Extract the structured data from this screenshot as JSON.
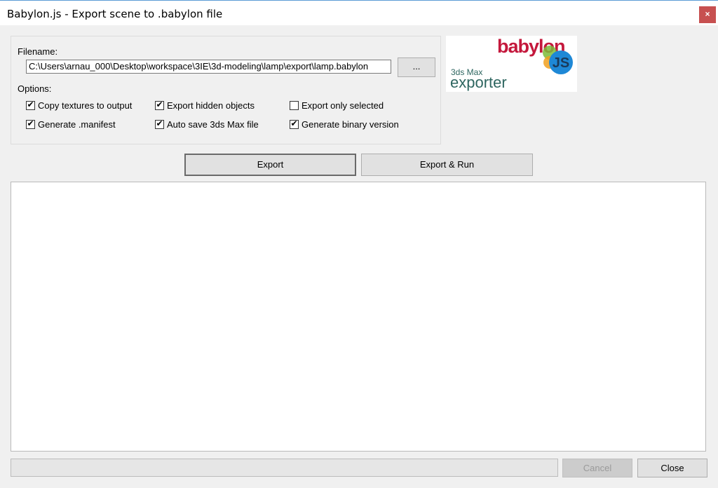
{
  "window": {
    "title": "Babylon.js - Export scene to .babylon file",
    "close_glyph": "×"
  },
  "filename": {
    "label": "Filename:",
    "value": "C:\\Users\\arnau_000\\Desktop\\workspace\\3IE\\3d-modeling\\lamp\\export\\lamp.babylon",
    "browse_label": "..."
  },
  "options": {
    "label": "Options:",
    "checkboxes": [
      {
        "label": "Copy textures to output",
        "checked": true
      },
      {
        "label": "Export hidden objects",
        "checked": true
      },
      {
        "label": "Export only selected",
        "checked": false
      },
      {
        "label": "Generate .manifest",
        "checked": true
      },
      {
        "label": "Auto save 3ds Max file",
        "checked": true
      },
      {
        "label": "Generate binary version",
        "checked": true
      }
    ]
  },
  "logo": {
    "brand": "babylon",
    "badge": "JS",
    "product_small": "3ds Max",
    "product_big": "exporter",
    "colors": {
      "brand": "#c4183c",
      "teal": "#2e6660",
      "blue": "#1e88d6",
      "green": "#7dbb3a",
      "orange": "#f0a020"
    }
  },
  "actions": {
    "export_label": "Export",
    "export_run_label": "Export & Run"
  },
  "footer": {
    "progress": 0,
    "cancel_label": "Cancel",
    "close_label": "Close"
  }
}
